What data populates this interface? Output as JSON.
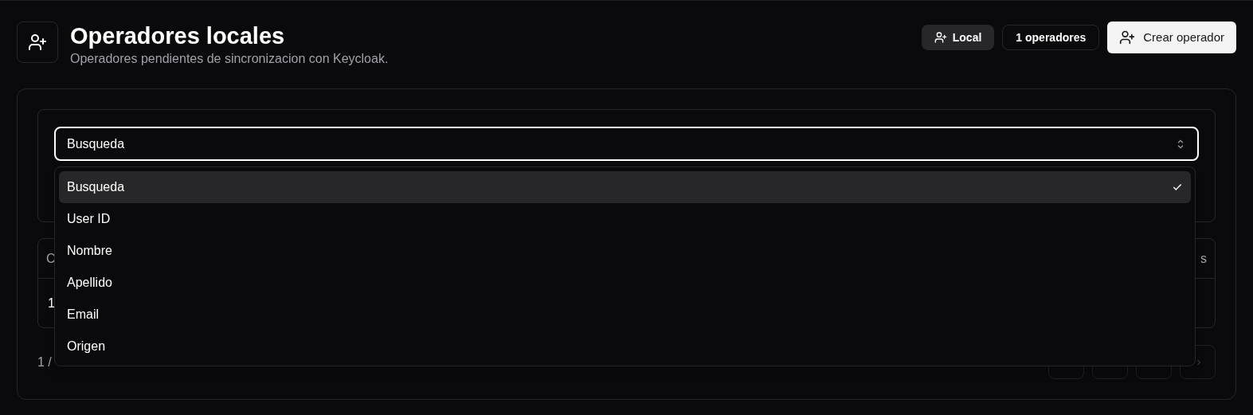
{
  "header": {
    "title": "Operadores locales",
    "subtitle": "Operadores pendientes de sincronizacion con Keycloak.",
    "badges": [
      {
        "label": "Local",
        "kind": "filled"
      },
      {
        "label": "1 operadores",
        "kind": "outline"
      }
    ],
    "create_button": "Crear operador"
  },
  "filter": {
    "select": {
      "value": "Busqueda",
      "expanded": true,
      "options": [
        {
          "label": "Busqueda",
          "selected": true
        },
        {
          "label": "User ID",
          "selected": false
        },
        {
          "label": "Nombre",
          "selected": false
        },
        {
          "label": "Apellido",
          "selected": false
        },
        {
          "label": "Email",
          "selected": false
        },
        {
          "label": "Origen",
          "selected": false
        }
      ]
    }
  },
  "table": {
    "columns": [
      "C",
      "s"
    ],
    "rows": [
      [
        "1"
      ]
    ]
  },
  "pagination": {
    "text": "1 /"
  }
}
